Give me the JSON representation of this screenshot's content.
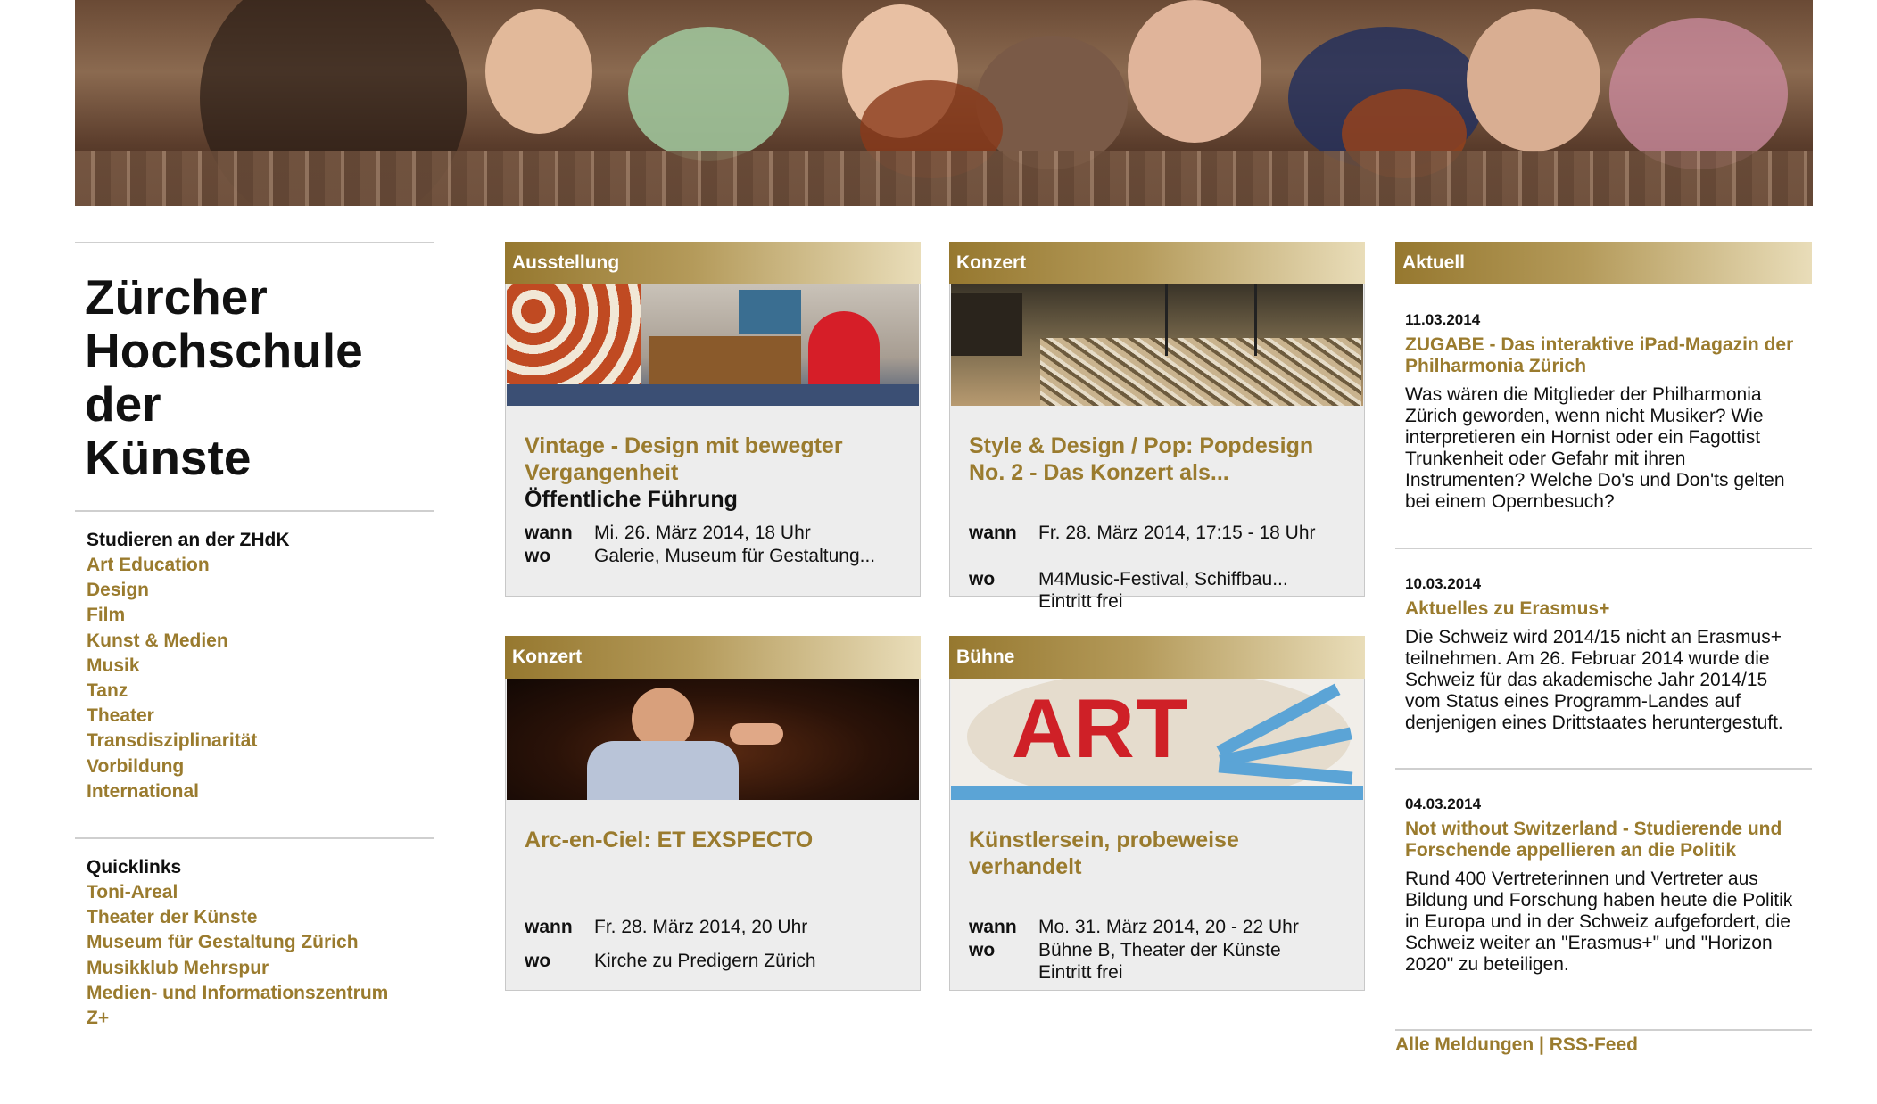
{
  "site": {
    "title_lines": [
      "Zürcher",
      "Hochschule",
      "der",
      "Künste"
    ]
  },
  "nav": {
    "study_heading": "Studieren an der ZHdK",
    "study_items": [
      "Art Education",
      "Design",
      "Film",
      "Kunst & Medien",
      "Musik",
      "Tanz",
      "Theater",
      "Transdisziplinarität",
      "Vorbildung",
      "International"
    ],
    "quicklinks_heading": "Quicklinks",
    "quicklinks_items": [
      "Toni-Areal",
      "Theater der Künste",
      "Museum für Gestaltung Zürich",
      "Musikklub Mehrspur",
      "Medien- und Informationszentrum",
      "Z+"
    ]
  },
  "events": [
    {
      "category": "Ausstellung",
      "title": "Vintage - Design mit bewegter Vergangenheit",
      "subtitle": "Öffentliche Führung",
      "wann_label": "wann",
      "wann": "Mi. 26. März 2014, 18 Uhr",
      "wo_label": "wo",
      "wo": "Galerie, Museum für Gestaltung..."
    },
    {
      "category": "Konzert",
      "title": "Style & Design / Pop: Popdesign No. 2 - Das Konzert als...",
      "subtitle": "",
      "wann_label": "wann",
      "wann": "Fr. 28. März 2014, 17:15 - 18 Uhr",
      "wo_label": "wo",
      "wo": "M4Music-Festival, Schiffbau... Eintritt frei"
    },
    {
      "category": "Konzert",
      "title": "Arc-en-Ciel: ET EXSPECTO",
      "subtitle": "",
      "wann_label": "wann",
      "wann": "Fr. 28. März 2014, 20 Uhr",
      "wo_label": "wo",
      "wo": "Kirche zu Predigern Zürich"
    },
    {
      "category": "Bühne",
      "title": "Künstlersein, probeweise verhandelt",
      "subtitle": "",
      "wann_label": "wann",
      "wann": "Mo. 31. März 2014, 20 - 22 Uhr",
      "wo_label": "wo",
      "wo": "Bühne B, Theater der Künste Eintritt frei"
    }
  ],
  "event_image_text": "ART",
  "news": {
    "heading": "Aktuell",
    "items": [
      {
        "date": "11.03.2014",
        "title": "ZUGABE - Das interaktive iPad-Magazin der Philharmonia Zürich",
        "text": "Was wären die Mitglieder der Philharmonia Zürich geworden, wenn nicht Musiker? Wie interpretieren ein Hornist oder ein Fagottist Trunkenheit oder Gefahr mit ihren Instrumenten? Welche Do's und Don'ts gelten bei einem Opernbesuch?"
      },
      {
        "date": "10.03.2014",
        "title": "Aktuelles zu Erasmus+",
        "text": "Die Schweiz wird 2014/15 nicht an Erasmus+ teilnehmen. Am 26. Februar 2014 wurde die Schweiz für das akademische Jahr 2014/15 vom Status eines Programm-Landes auf denjenigen eines Drittstaates heruntergestuft."
      },
      {
        "date": "04.03.2014",
        "title": "Not without Switzerland - Studierende und Forschende appellieren an die Politik",
        "text": "Rund 400 Vertreterinnen und Vertreter aus Bildung und Forschung haben heute die Politik in Europa und in der Schweiz aufgefordert, die Schweiz weiter an \"Erasmus+\" und \"Horizon 2020\" zu beteiligen."
      }
    ],
    "all_link": "Alle Meldungen",
    "separator": "|",
    "rss_link": "RSS-Feed"
  },
  "colors": {
    "accent": "#9a7b2e",
    "bar_start": "#96782f",
    "bar_end": "#e9ddb9",
    "card_bg": "#ededed"
  }
}
